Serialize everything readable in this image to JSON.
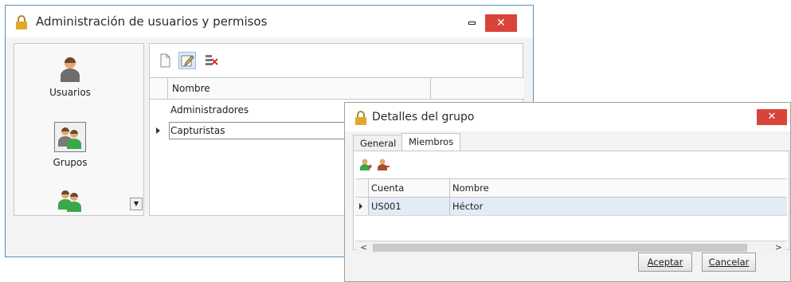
{
  "main_window": {
    "title": "Administración de usuarios y permisos",
    "close_label": "✕",
    "sidebar": {
      "items": [
        {
          "label": "Usuarios",
          "icon": "user-icon"
        },
        {
          "label": "Grupos",
          "icon": "group-icon",
          "selected": true
        },
        {
          "label": "",
          "icon": "group-permissions-icon"
        }
      ]
    },
    "toolbar": {
      "buttons": [
        {
          "icon": "new-document-icon"
        },
        {
          "icon": "edit-icon",
          "active": true
        },
        {
          "icon": "delete-icon"
        }
      ]
    },
    "grid": {
      "columns": [
        "Nombre",
        ""
      ],
      "rows": [
        {
          "nombre": "Administradores"
        },
        {
          "nombre": "Capturistas",
          "current": true
        }
      ]
    }
  },
  "detail_window": {
    "title": "Detalles del grupo",
    "close_label": "✕",
    "tabs": [
      {
        "label": "General"
      },
      {
        "label": "Miembros",
        "active": true
      }
    ],
    "toolbar": {
      "buttons": [
        {
          "icon": "add-member-icon"
        },
        {
          "icon": "remove-member-icon"
        }
      ]
    },
    "grid": {
      "columns": [
        "Cuenta",
        "Nombre"
      ],
      "rows": [
        {
          "cuenta": "US001",
          "nombre": "Héctor"
        }
      ]
    },
    "scroll_left": "<",
    "scroll_right": ">",
    "accept_label": "Aceptar",
    "cancel_label": "Cancelar"
  },
  "colors": {
    "accent_border": "#5a8ec6",
    "close_button": "#d9443a",
    "selected_row": "#e3ecf6"
  }
}
